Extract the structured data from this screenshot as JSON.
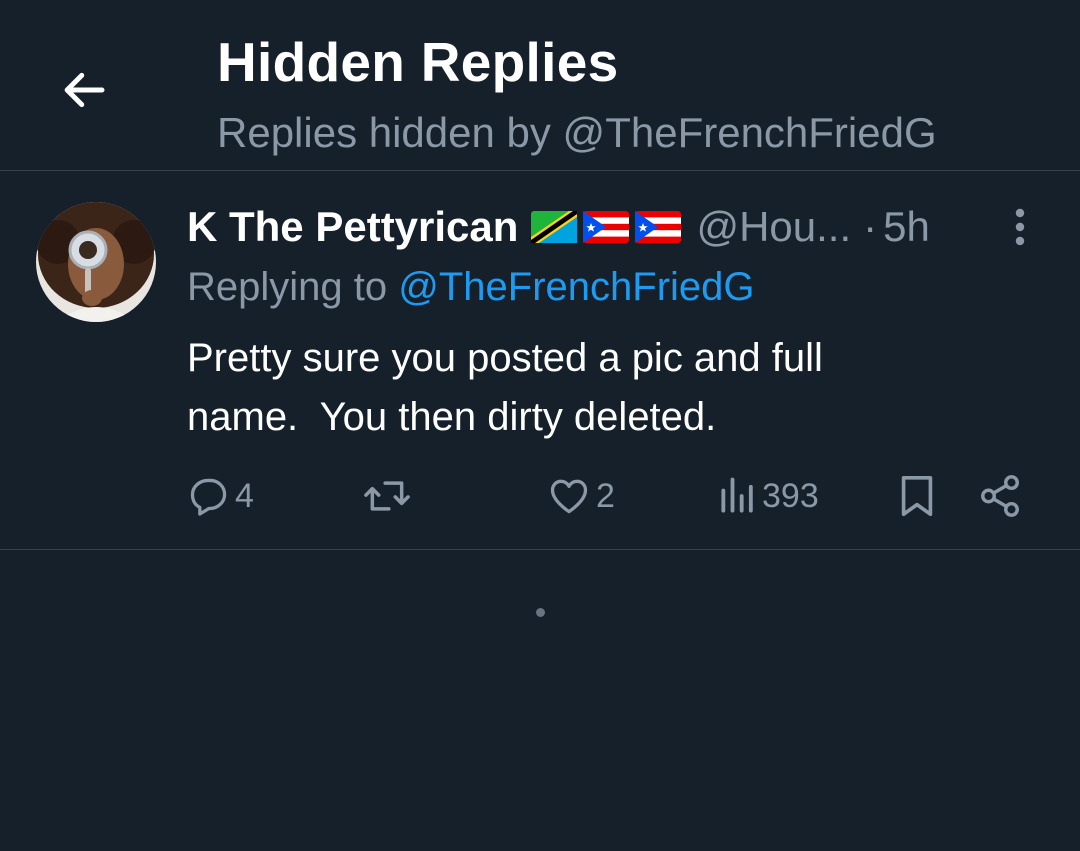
{
  "header": {
    "title": "Hidden Replies",
    "subtitle": "Replies hidden by @TheFrenchFriedG",
    "back_icon": "arrow-left-icon"
  },
  "tweet": {
    "display_name": "K The Pettyrican",
    "flags": [
      "tanzania-flag",
      "puerto-rico-flag",
      "puerto-rico-flag"
    ],
    "handle": "@Hou...",
    "separator": "·",
    "time": "5h",
    "reply_prefix": "Replying to ",
    "reply_mention": "@TheFrenchFriedG",
    "text": "Pretty sure you posted a pic and full\nname.  You then dirty deleted.",
    "actions": {
      "replies": "4",
      "retweets": "",
      "likes": "2",
      "views": "393"
    }
  },
  "colors": {
    "background": "#15202b",
    "secondary_text": "#8b98a5",
    "accent": "#1d9bf0",
    "divider": "#38444d"
  }
}
